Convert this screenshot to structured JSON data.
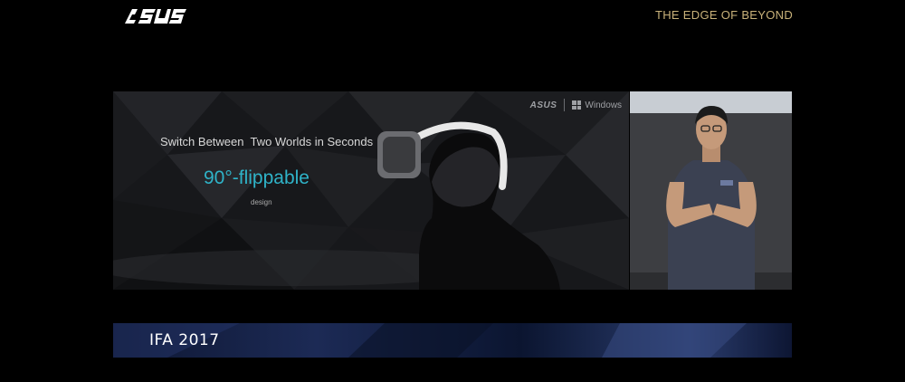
{
  "header": {
    "logo_text": "ASUS",
    "tagline": "THE EDGE OF BEYOND"
  },
  "slide": {
    "brand": "ASUS",
    "os_label": "Windows",
    "headline": "Switch Between  Two Worlds in Seconds",
    "feature": "90°-flippable",
    "feature_sub": "design"
  },
  "footer": {
    "event": "IFA 2017"
  },
  "colors": {
    "tagline": "#c9b27a",
    "feature_accent": "#2fb3c8",
    "footer_bar": "#1c2a55"
  }
}
